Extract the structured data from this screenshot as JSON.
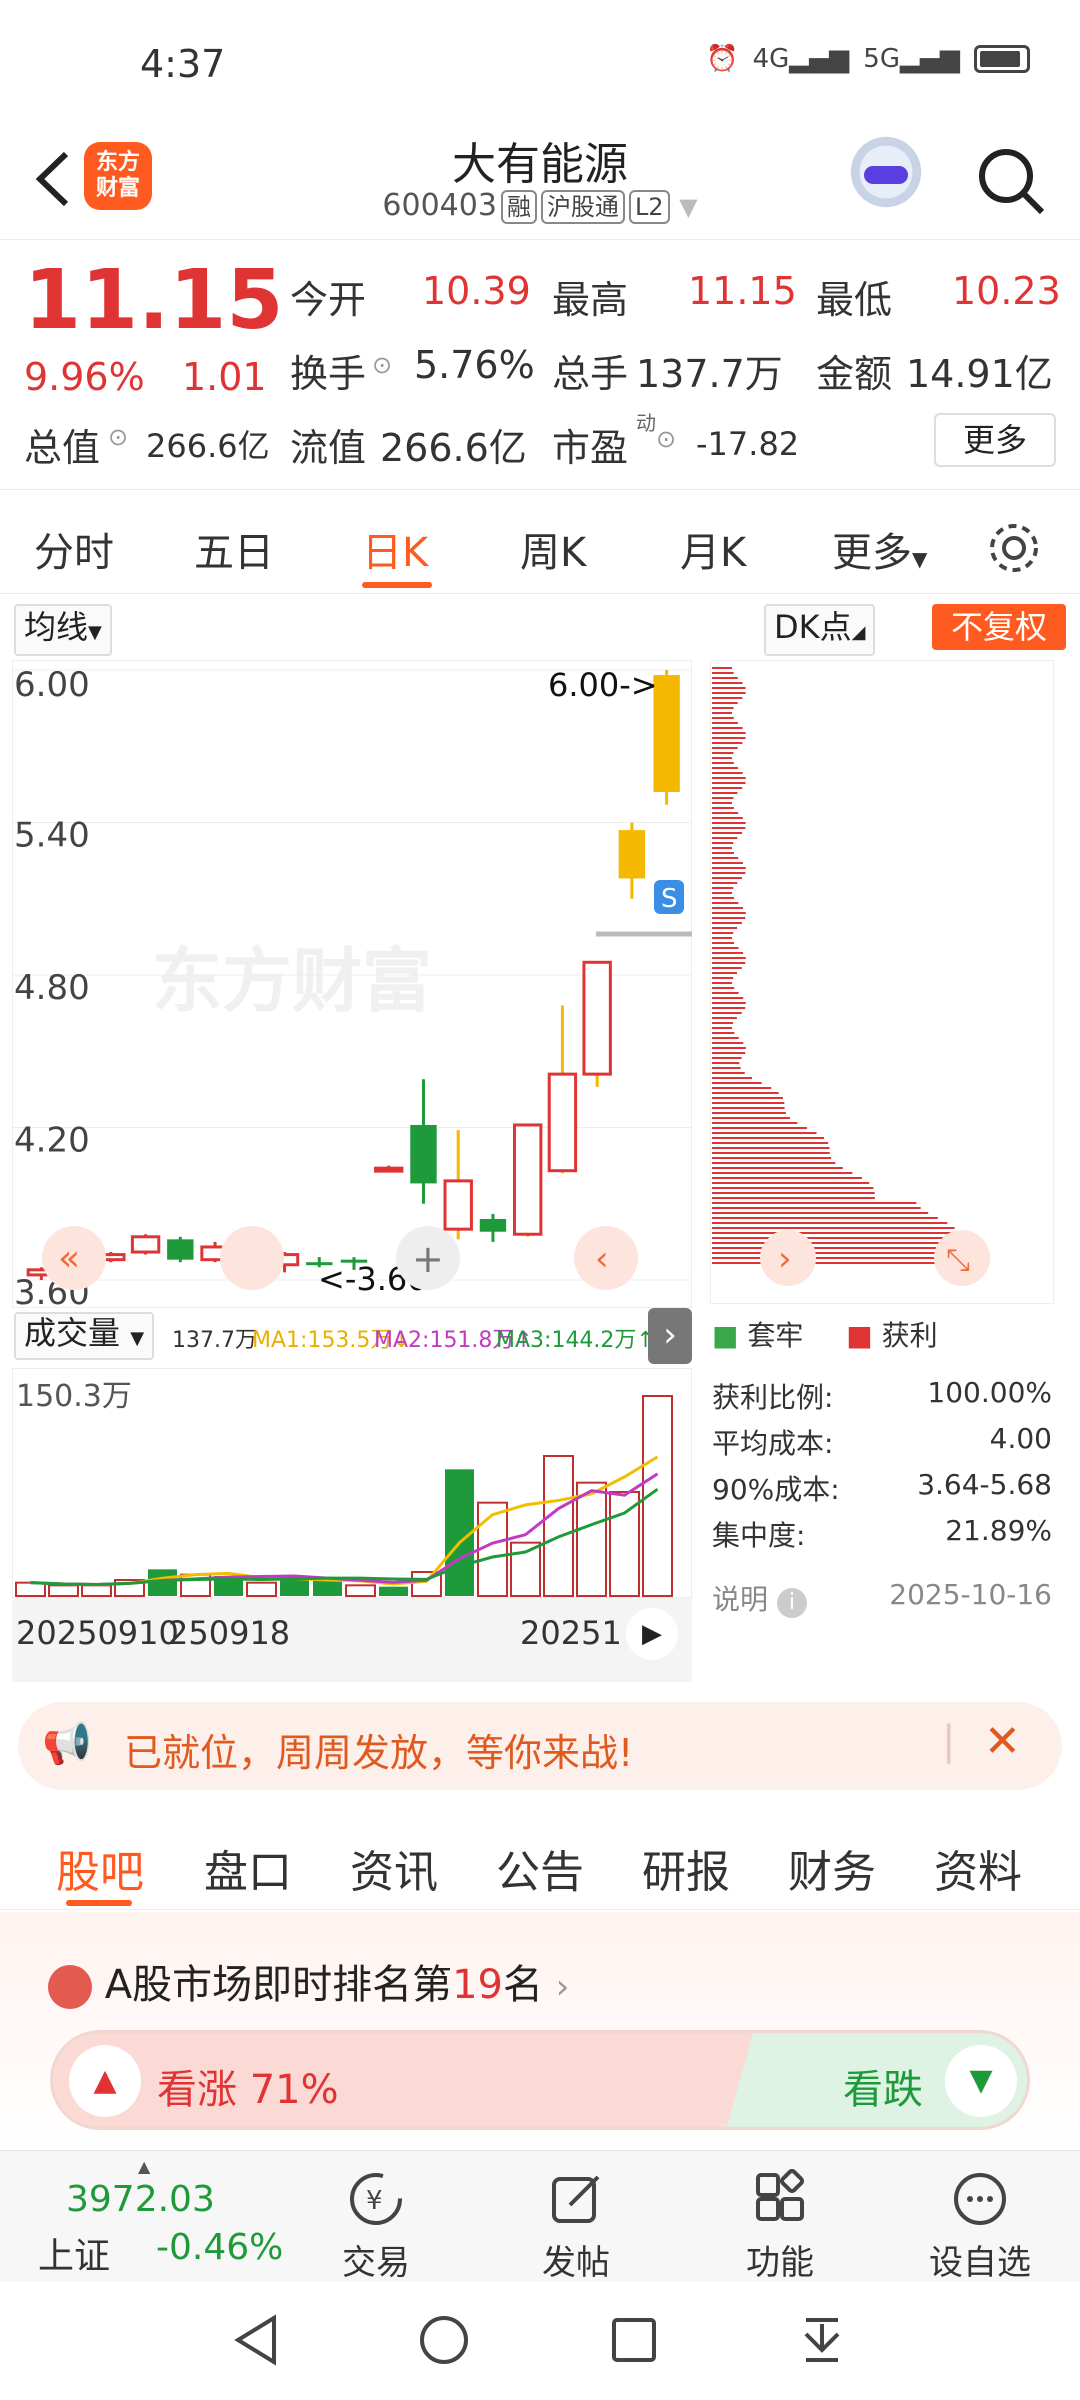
{
  "status": {
    "time": "4:37",
    "net1": "4G",
    "net2": "5G"
  },
  "header": {
    "name": "大有能源",
    "code": "600403",
    "tags": [
      "融",
      "沪股通",
      "L2"
    ],
    "logo": "东方\n财富"
  },
  "quote": {
    "price": "11.15",
    "pct": "9.96%",
    "chg": "1.01",
    "open_label": "今开",
    "open": "10.39",
    "high_label": "最高",
    "high": "11.15",
    "low_label": "最低",
    "low": "10.23",
    "turnover_label": "换手",
    "turnover": "5.76%",
    "vol_label": "总手",
    "vol": "137.7万",
    "amount_label": "金额",
    "amount": "14.91亿",
    "mcap_label": "总值",
    "mcap": "266.6亿",
    "float_label": "流值",
    "float": "266.6亿",
    "pe_label": "市盈",
    "pe_sup": "动",
    "pe": "-17.82",
    "more": "更多"
  },
  "chart_tabs": [
    "分时",
    "五日",
    "日K",
    "周K",
    "月K",
    "更多"
  ],
  "chart_controls": {
    "ma": "均线",
    "dk": "DK点",
    "fq": "不复权"
  },
  "chart_data": {
    "type": "candlestick",
    "yticks": [
      "6.00",
      "5.40",
      "4.80",
      "4.20",
      "3.60"
    ],
    "ylim": [
      3.6,
      6.0
    ],
    "max_label": "6.00->",
    "min_label": "<-3.60",
    "candles": [
      {
        "o": 3.62,
        "c": 3.64,
        "h": 3.65,
        "l": 3.6
      },
      {
        "o": 3.64,
        "c": 3.68,
        "h": 3.69,
        "l": 3.63
      },
      {
        "o": 3.68,
        "c": 3.7,
        "h": 3.71,
        "l": 3.67
      },
      {
        "o": 3.71,
        "c": 3.77,
        "h": 3.78,
        "l": 3.7
      },
      {
        "o": 3.76,
        "c": 3.68,
        "h": 3.77,
        "l": 3.67
      },
      {
        "o": 3.68,
        "c": 3.73,
        "h": 3.75,
        "l": 3.67
      },
      {
        "o": 3.74,
        "c": 3.67,
        "h": 3.75,
        "l": 3.66
      },
      {
        "o": 3.66,
        "c": 3.7,
        "h": 3.71,
        "l": 3.63
      },
      {
        "o": 3.67,
        "c": 3.66,
        "h": 3.69,
        "l": 3.65
      },
      {
        "o": 3.68,
        "c": 3.67,
        "h": 3.69,
        "l": 3.64
      },
      {
        "o": 4.04,
        "c": 4.04,
        "h": 4.05,
        "l": 4.03
      },
      {
        "o": 4.21,
        "c": 3.98,
        "h": 4.39,
        "l": 3.9
      },
      {
        "o": 3.8,
        "c": 3.99,
        "h": 4.19,
        "l": 3.76
      },
      {
        "o": 3.84,
        "c": 3.79,
        "h": 3.86,
        "l": 3.75
      },
      {
        "o": 3.78,
        "c": 4.21,
        "h": 4.21,
        "l": 3.77
      },
      {
        "o": 4.03,
        "c": 4.41,
        "h": 4.68,
        "l": 4.02
      },
      {
        "o": 4.41,
        "c": 4.85,
        "h": 4.85,
        "l": 4.36
      },
      {
        "o": 5.18,
        "c": 5.37,
        "h": 5.4,
        "l": 5.1
      },
      {
        "o": 5.52,
        "c": 5.98,
        "h": 6.0,
        "l": 5.47
      }
    ],
    "volume": {
      "label": "成交量",
      "last": "137.7万",
      "ma1": "MA1:153.5万↓",
      "ma2": "MA2:151.8万↑",
      "ma3": "MA3:144.2万↑",
      "ymax_label": "150.3万",
      "values": [
        10,
        8,
        8,
        12,
        20,
        16,
        15,
        10,
        14,
        12,
        8,
        7,
        18,
        95,
        70,
        40,
        105,
        85,
        78,
        150
      ]
    },
    "dates": [
      "20250910",
      "250918",
      "20251"
    ],
    "chip_legend": [
      "套牢",
      "获利"
    ]
  },
  "chip_stats": [
    {
      "label": "获利比例:",
      "value": "100.00%"
    },
    {
      "label": "平均成本:",
      "value": "4.00"
    },
    {
      "label": "90%成本:",
      "value": "3.64-5.68"
    },
    {
      "label": "集中度:",
      "value": "21.89%"
    }
  ],
  "chip_note": {
    "label": "说明",
    "date": "2025-10-16"
  },
  "banner": {
    "text": "已就位，周周发放，等你来战!"
  },
  "section_tabs": [
    "股吧",
    "盘口",
    "资讯",
    "公告",
    "研报",
    "财务",
    "资料"
  ],
  "rank": {
    "prefix": "A股市场即时排名第",
    "num": "19",
    "suffix": "名"
  },
  "vote": {
    "up_label": "看涨 71%",
    "down_label": "看跌"
  },
  "index": {
    "value": "3972.03",
    "name": "上证",
    "pct": "-0.46%"
  },
  "bottom_nav": [
    "交易",
    "发帖",
    "功能",
    "设自选"
  ],
  "colors": {
    "accent": "#ff5a1f",
    "up": "#e03434",
    "down": "#1f9a3a",
    "candle_up_yellow": "#f5b800"
  }
}
